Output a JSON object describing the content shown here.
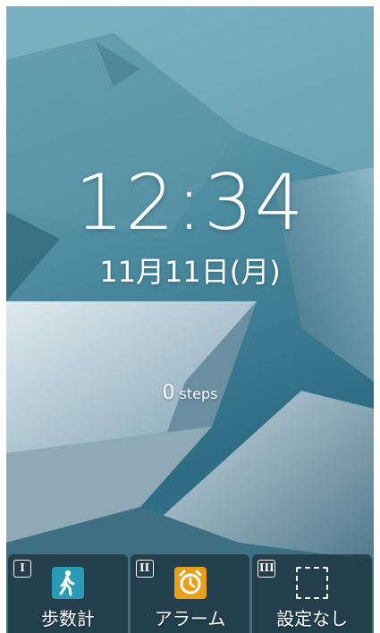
{
  "lock_screen": {
    "time": "12:34",
    "date": "11月11日(月)",
    "steps_count": "0",
    "steps_unit": "steps"
  },
  "softkeys": [
    {
      "number": "I",
      "icon": "pedometer-icon",
      "label": "歩数計",
      "icon_color": "#2a9bb6"
    },
    {
      "number": "II",
      "icon": "alarm-clock-icon",
      "label": "アラーム",
      "icon_color": "#e8a01c"
    },
    {
      "number": "III",
      "icon": "empty-slot-icon",
      "label": "設定なし"
    }
  ],
  "colors": {
    "wallpaper": "#4f8ea2",
    "softkey_bg": "#192d37"
  }
}
